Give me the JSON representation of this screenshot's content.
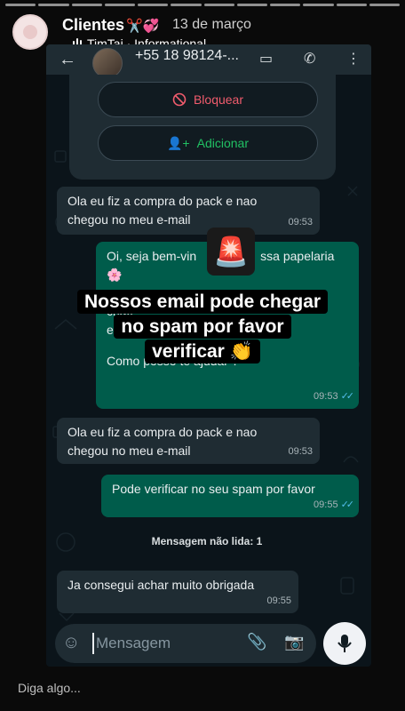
{
  "story": {
    "name": "Clientes",
    "name_emojis": "✂️💞",
    "date": "13 de março",
    "subtitle": "TimTaj · Informational"
  },
  "chat": {
    "contact": "+55 18 98124-...",
    "buttons": {
      "block": "Bloquear",
      "add": "Adicionar"
    },
    "messages": [
      {
        "dir": "in",
        "text_line1": "Ola eu fiz a compra do pack e nao",
        "text_line2": "chegou no meu e-mail",
        "time": "09:53"
      },
      {
        "dir": "out",
        "text_line1": "Oi, seja bem-vin",
        "text_line1b": "ssa papelaria",
        "text_line2": "🌸",
        "text_line3": "criati",
        "text_line4": "e cheios de",
        "text_line5": "Como posso te ajudar ?",
        "time": "09:53"
      },
      {
        "dir": "in",
        "text_line1": "Ola eu fiz a compra do pack e nao",
        "text_line2": "chegou no meu e-mail",
        "time": "09:53"
      },
      {
        "dir": "out",
        "text_line1": "Pode verificar no seu spam por favor",
        "time": "09:55"
      },
      {
        "dir": "in",
        "text_line1": "Ja consegui achar muito obrigada",
        "time": "09:55"
      }
    ],
    "unread_label": "Mensagem não lida: 1",
    "input_placeholder": "Mensagem"
  },
  "overlay": {
    "siren_emoji": "🚨",
    "caption_line1": "Nossos email pode chegar",
    "caption_line2": "no spam por favor",
    "caption_line3": "verificar",
    "caption_emoji": "👏"
  },
  "reply_placeholder": "Diga algo...",
  "colors": {
    "bubble_out": "#005c4b",
    "bubble_in": "#1f2c33",
    "block_red": "#f15c6d",
    "add_green": "#21c063",
    "read_ticks": "#53bdeb"
  }
}
